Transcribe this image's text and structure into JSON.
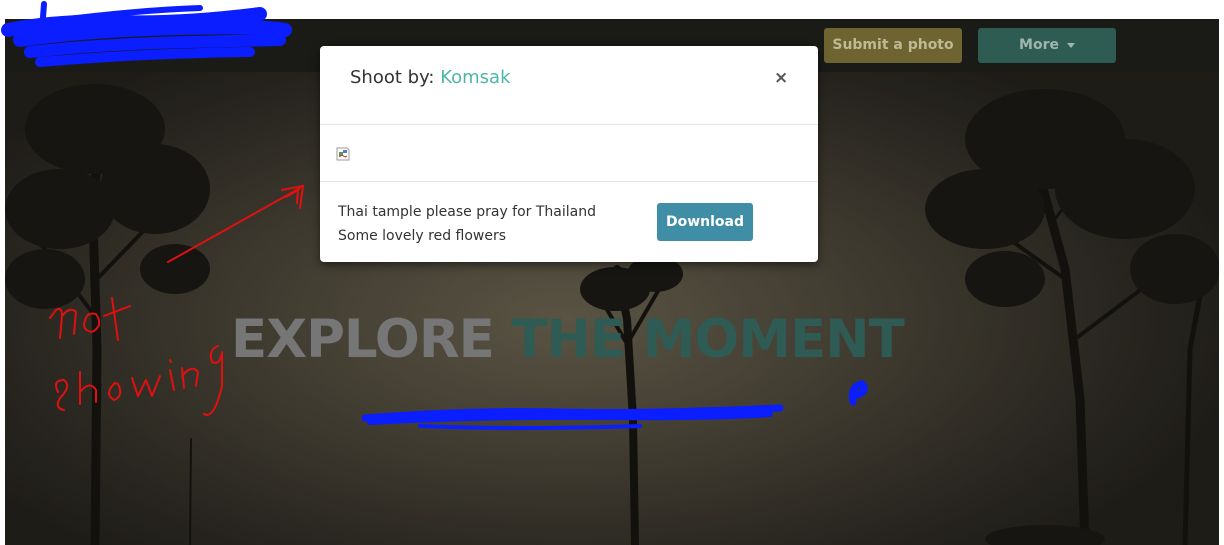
{
  "navbar": {
    "submit_label": "Submit a photo",
    "more_label": "More"
  },
  "hero": {
    "title_part1": "EXPLORE",
    "title_part2": "THE MOMENT"
  },
  "modal": {
    "title_prefix": "Shoot by: ",
    "author": "Komsak",
    "close_label": "×",
    "description_line1": "Thai tample please pray for Thailand",
    "description_line2": "Some lovely red flowers",
    "download_label": "Download"
  },
  "annotation": {
    "handwritten_note": "not showing"
  },
  "colors": {
    "author_link": "#4db6a6",
    "download_button": "#3f8ea6",
    "submit_button": "#6e6432",
    "more_button": "#2e5b52",
    "title_accent": "#2e5b53",
    "annotation_red": "#e01010",
    "redaction_blue": "#0a1eff"
  }
}
